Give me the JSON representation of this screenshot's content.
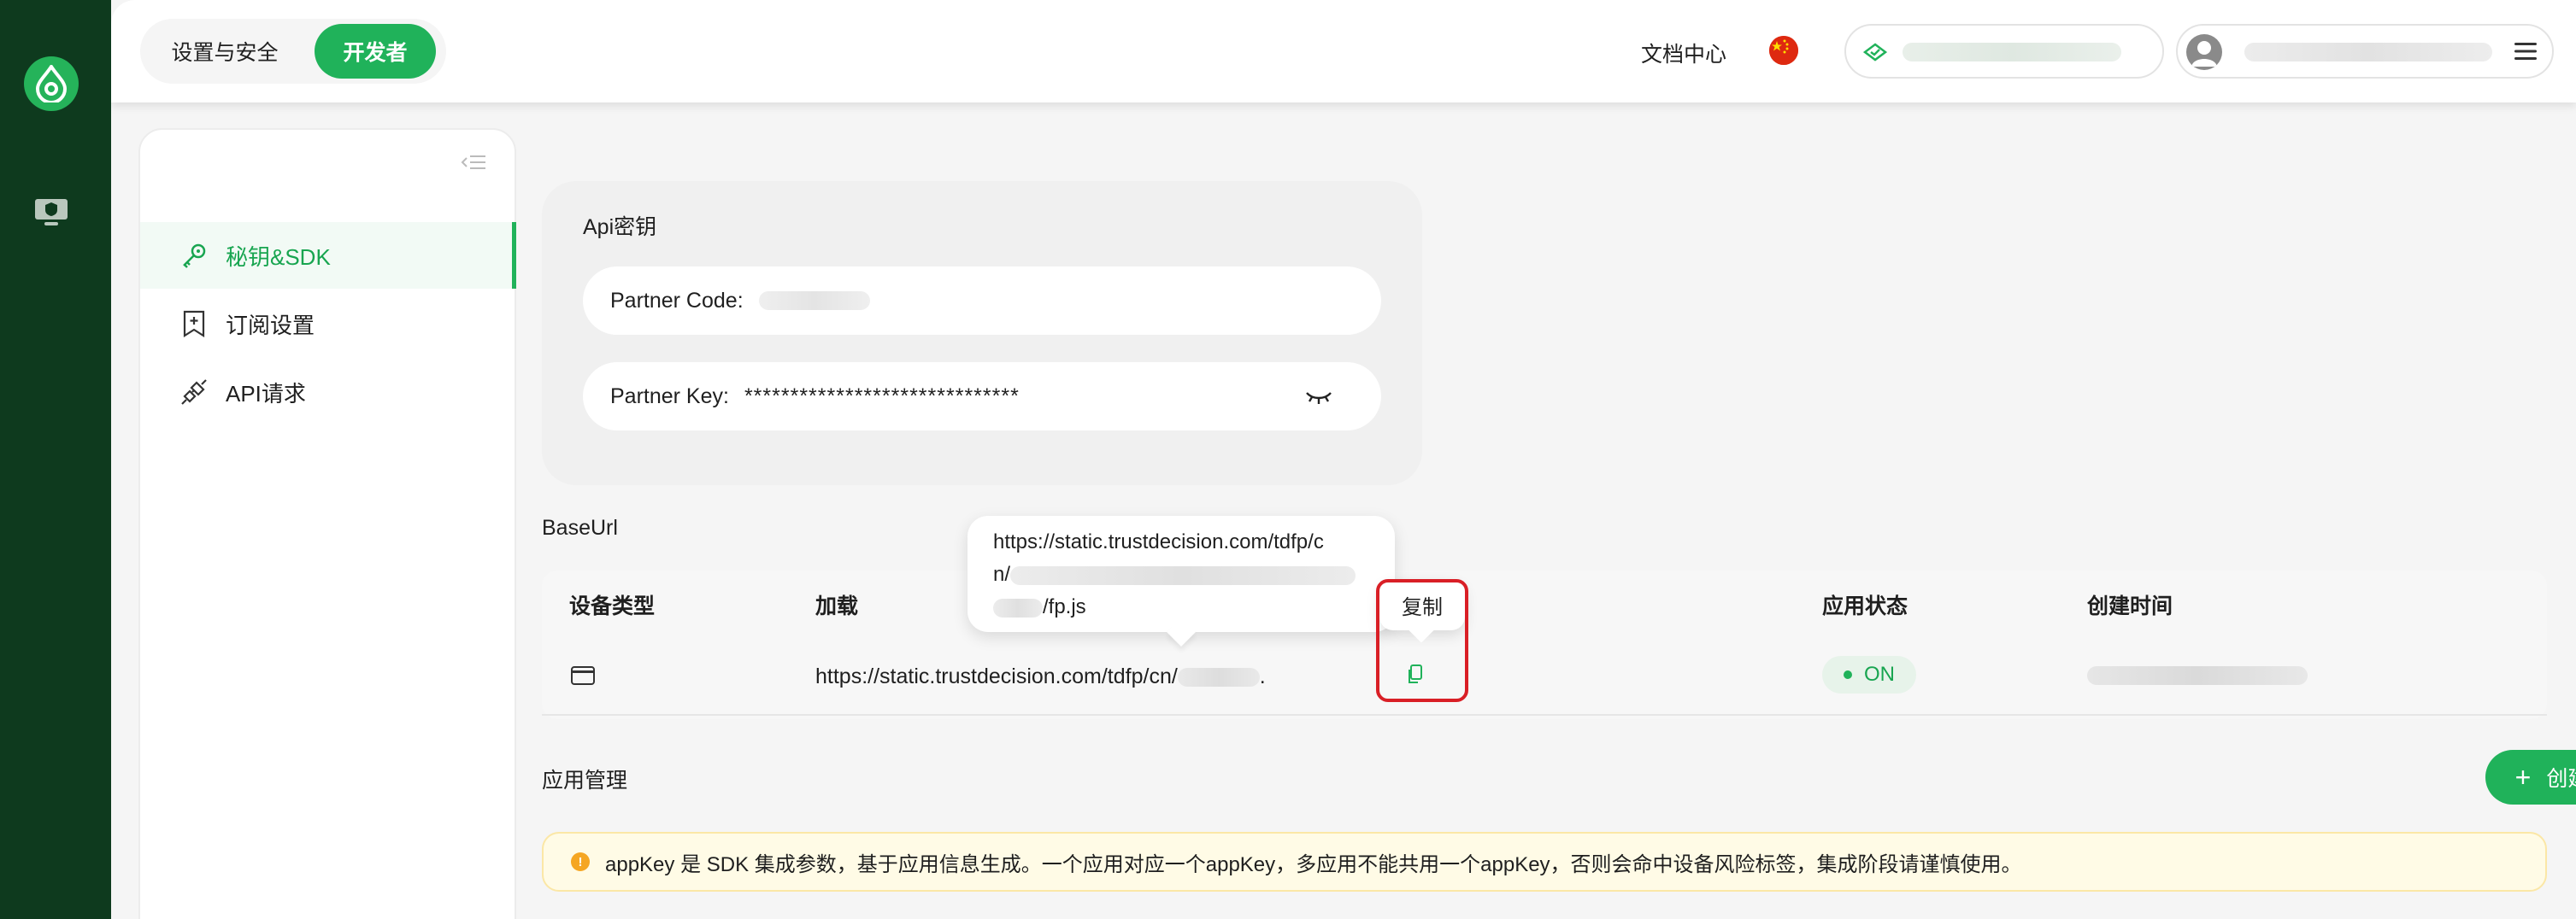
{
  "nav_tabs": [
    {
      "label": "设置与安全",
      "active": false
    },
    {
      "label": "开发者",
      "active": true
    }
  ],
  "header": {
    "docs_label": "文档中心",
    "language_flag": "cn-flag"
  },
  "sidebar": {
    "items": [
      {
        "label": "秘钥&SDK",
        "icon": "key-icon",
        "active": true
      },
      {
        "label": "订阅设置",
        "icon": "bookmark-icon",
        "active": false
      },
      {
        "label": "API请求",
        "icon": "plug-icon",
        "active": false
      }
    ]
  },
  "api_keys": {
    "title": "Api密钥",
    "partner_code_label": "Partner Code:",
    "partner_key_label": "Partner Key:",
    "partner_key_value": "******************************"
  },
  "baseurl": {
    "title": "BaseUrl",
    "columns": [
      "设备类型",
      "加载",
      "应用状态",
      "创建时间"
    ],
    "row": {
      "url": "https://static.trustdecision.com/tdfp/cn/",
      "url_end": ".",
      "status": "ON"
    }
  },
  "tooltip": {
    "url_line1": "https://static.trustdecision.com/tdfp/c",
    "url_line2": "n/",
    "url_line3": "/fp.js",
    "copy_label": "复制"
  },
  "app_management": {
    "title": "应用管理",
    "create_button": "创建应用",
    "notice": "appKey 是 SDK 集成参数，基于应用信息生成。一个应用对应一个appKey，多应用不能共用一个appKey，否则会命中设备风险标签，集成阶段请谨慎使用。"
  },
  "colors": {
    "brand_green": "#20b25a",
    "rail_dark": "#0e3a1e",
    "highlight_red": "#d91f26"
  }
}
